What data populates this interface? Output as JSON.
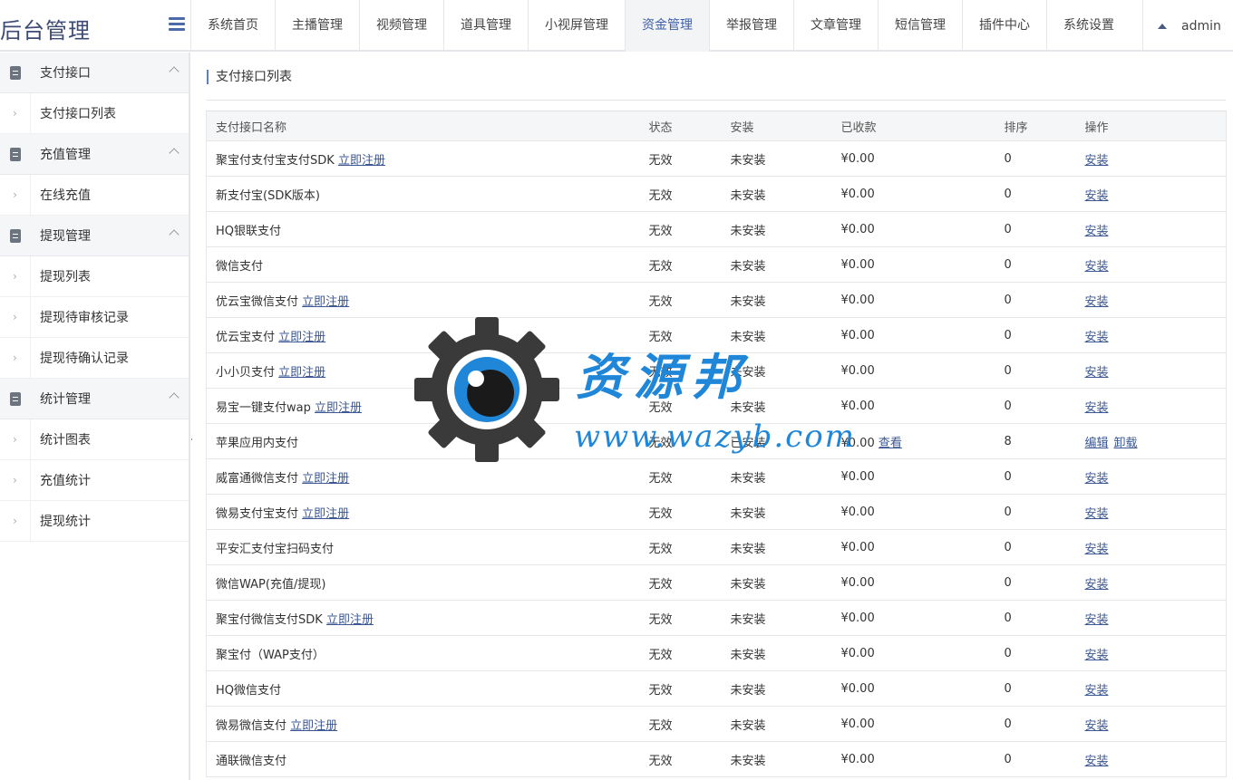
{
  "header": {
    "brand": "后台管理",
    "nav": [
      "系统首页",
      "主播管理",
      "视频管理",
      "道具管理",
      "小视屏管理",
      "资金管理",
      "举报管理",
      "文章管理",
      "短信管理",
      "插件中心",
      "系统设置"
    ],
    "active_nav": "资金管理",
    "user": "admin"
  },
  "sidebar": {
    "groups": [
      {
        "label": "支付接口",
        "items": [
          "支付接口列表"
        ]
      },
      {
        "label": "充值管理",
        "items": [
          "在线充值"
        ]
      },
      {
        "label": "提现管理",
        "items": [
          "提现列表",
          "提现待审核记录",
          "提现待确认记录"
        ]
      },
      {
        "label": "统计管理",
        "items": [
          "统计图表",
          "充值统计",
          "提现统计"
        ]
      }
    ]
  },
  "main": {
    "title": "支付接口列表",
    "columns": [
      "支付接口名称",
      "状态",
      "安装",
      "已收款",
      "排序",
      "操作"
    ],
    "rows": [
      {
        "name": "聚宝付支付宝支付SDK",
        "reg": "立即注册",
        "status": "无效",
        "install": "未安装",
        "amount": "¥0.00",
        "view": "",
        "sort": "0",
        "ops": [
          "安装"
        ]
      },
      {
        "name": "新支付宝(SDK版本)",
        "reg": "",
        "status": "无效",
        "install": "未安装",
        "amount": "¥0.00",
        "view": "",
        "sort": "0",
        "ops": [
          "安装"
        ]
      },
      {
        "name": "HQ银联支付",
        "reg": "",
        "status": "无效",
        "install": "未安装",
        "amount": "¥0.00",
        "view": "",
        "sort": "0",
        "ops": [
          "安装"
        ]
      },
      {
        "name": "微信支付",
        "reg": "",
        "status": "无效",
        "install": "未安装",
        "amount": "¥0.00",
        "view": "",
        "sort": "0",
        "ops": [
          "安装"
        ]
      },
      {
        "name": "优云宝微信支付",
        "reg": "立即注册",
        "status": "无效",
        "install": "未安装",
        "amount": "¥0.00",
        "view": "",
        "sort": "0",
        "ops": [
          "安装"
        ]
      },
      {
        "name": "优云宝支付",
        "reg": "立即注册",
        "status": "无效",
        "install": "未安装",
        "amount": "¥0.00",
        "view": "",
        "sort": "0",
        "ops": [
          "安装"
        ]
      },
      {
        "name": "小小贝支付",
        "reg": "立即注册",
        "status": "无效",
        "install": "未安装",
        "amount": "¥0.00",
        "view": "",
        "sort": "0",
        "ops": [
          "安装"
        ]
      },
      {
        "name": "易宝一键支付wap",
        "reg": "立即注册",
        "status": "无效",
        "install": "未安装",
        "amount": "¥0.00",
        "view": "",
        "sort": "0",
        "ops": [
          "安装"
        ]
      },
      {
        "name": "苹果应用内支付",
        "reg": "",
        "status": "无效",
        "install": "已安装",
        "amount": "¥0.00",
        "view": "查看",
        "sort": "8",
        "ops": [
          "编辑",
          "卸载"
        ]
      },
      {
        "name": "威富通微信支付",
        "reg": "立即注册",
        "status": "无效",
        "install": "未安装",
        "amount": "¥0.00",
        "view": "",
        "sort": "0",
        "ops": [
          "安装"
        ]
      },
      {
        "name": "微易支付宝支付",
        "reg": "立即注册",
        "status": "无效",
        "install": "未安装",
        "amount": "¥0.00",
        "view": "",
        "sort": "0",
        "ops": [
          "安装"
        ]
      },
      {
        "name": "平安汇支付宝扫码支付",
        "reg": "",
        "status": "无效",
        "install": "未安装",
        "amount": "¥0.00",
        "view": "",
        "sort": "0",
        "ops": [
          "安装"
        ]
      },
      {
        "name": "微信WAP(充值/提现)",
        "reg": "",
        "status": "无效",
        "install": "未安装",
        "amount": "¥0.00",
        "view": "",
        "sort": "0",
        "ops": [
          "安装"
        ]
      },
      {
        "name": "聚宝付微信支付SDK",
        "reg": "立即注册",
        "status": "无效",
        "install": "未安装",
        "amount": "¥0.00",
        "view": "",
        "sort": "0",
        "ops": [
          "安装"
        ]
      },
      {
        "name": "聚宝付（WAP支付）",
        "reg": "",
        "status": "无效",
        "install": "未安装",
        "amount": "¥0.00",
        "view": "",
        "sort": "0",
        "ops": [
          "安装"
        ]
      },
      {
        "name": "HQ微信支付",
        "reg": "",
        "status": "无效",
        "install": "未安装",
        "amount": "¥0.00",
        "view": "",
        "sort": "0",
        "ops": [
          "安装"
        ]
      },
      {
        "name": "微易微信支付",
        "reg": "立即注册",
        "status": "无效",
        "install": "未安装",
        "amount": "¥0.00",
        "view": "",
        "sort": "0",
        "ops": [
          "安装"
        ]
      },
      {
        "name": "通联微信支付",
        "reg": "",
        "status": "无效",
        "install": "未安装",
        "amount": "¥0.00",
        "view": "",
        "sort": "0",
        "ops": [
          "安装"
        ]
      }
    ]
  },
  "watermark": {
    "text": "资源邦",
    "url": "www.wazyb.com"
  },
  "colors": {
    "brand": "#3d4a74",
    "accent": "#3d5ea8",
    "link": "#3b5794",
    "watermark": "#1f86d8"
  }
}
